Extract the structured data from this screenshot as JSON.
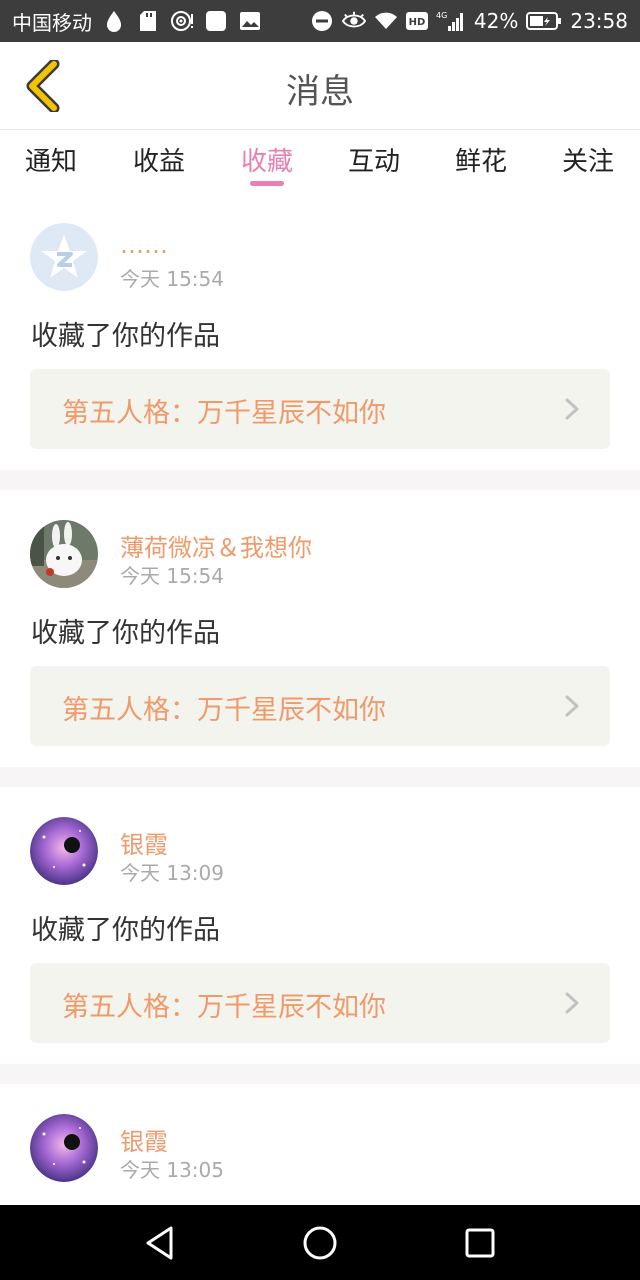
{
  "status_bar": {
    "carrier": "中国移动",
    "battery": "42%",
    "time": "23:58",
    "network": "4G",
    "hd": "HD"
  },
  "header": {
    "title": "消息",
    "back_icon": "chevron-left-icon"
  },
  "tabs": [
    {
      "label": "通知",
      "active": false
    },
    {
      "label": "收益",
      "active": false
    },
    {
      "label": "收藏",
      "active": true
    },
    {
      "label": "互动",
      "active": false
    },
    {
      "label": "鲜花",
      "active": false
    },
    {
      "label": "关注",
      "active": false
    }
  ],
  "notifications": [
    {
      "user": "……",
      "time": "今天 15:54",
      "action": "收藏了你的作品",
      "work": "第五人格：万千星辰不如你",
      "avatar": "default-qq-avatar"
    },
    {
      "user": "薄荷微凉＆我想你",
      "time": "今天 15:54",
      "action": "收藏了你的作品",
      "work": "第五人格：万千星辰不如你",
      "avatar": "bunny-avatar"
    },
    {
      "user": "银霞",
      "time": "今天 13:09",
      "action": "收藏了你的作品",
      "work": "第五人格：万千星辰不如你",
      "avatar": "galaxy-avatar"
    },
    {
      "user": "银霞",
      "time": "今天 13:05",
      "action": "",
      "work": "",
      "avatar": "galaxy-avatar"
    }
  ],
  "colors": {
    "accent_pink": "#e97fb2",
    "username_orange": "#ef9a6a",
    "card_bg": "#f4f4ef",
    "status_bar": "#3d3d3d",
    "back_chevron": "#f0c000"
  }
}
